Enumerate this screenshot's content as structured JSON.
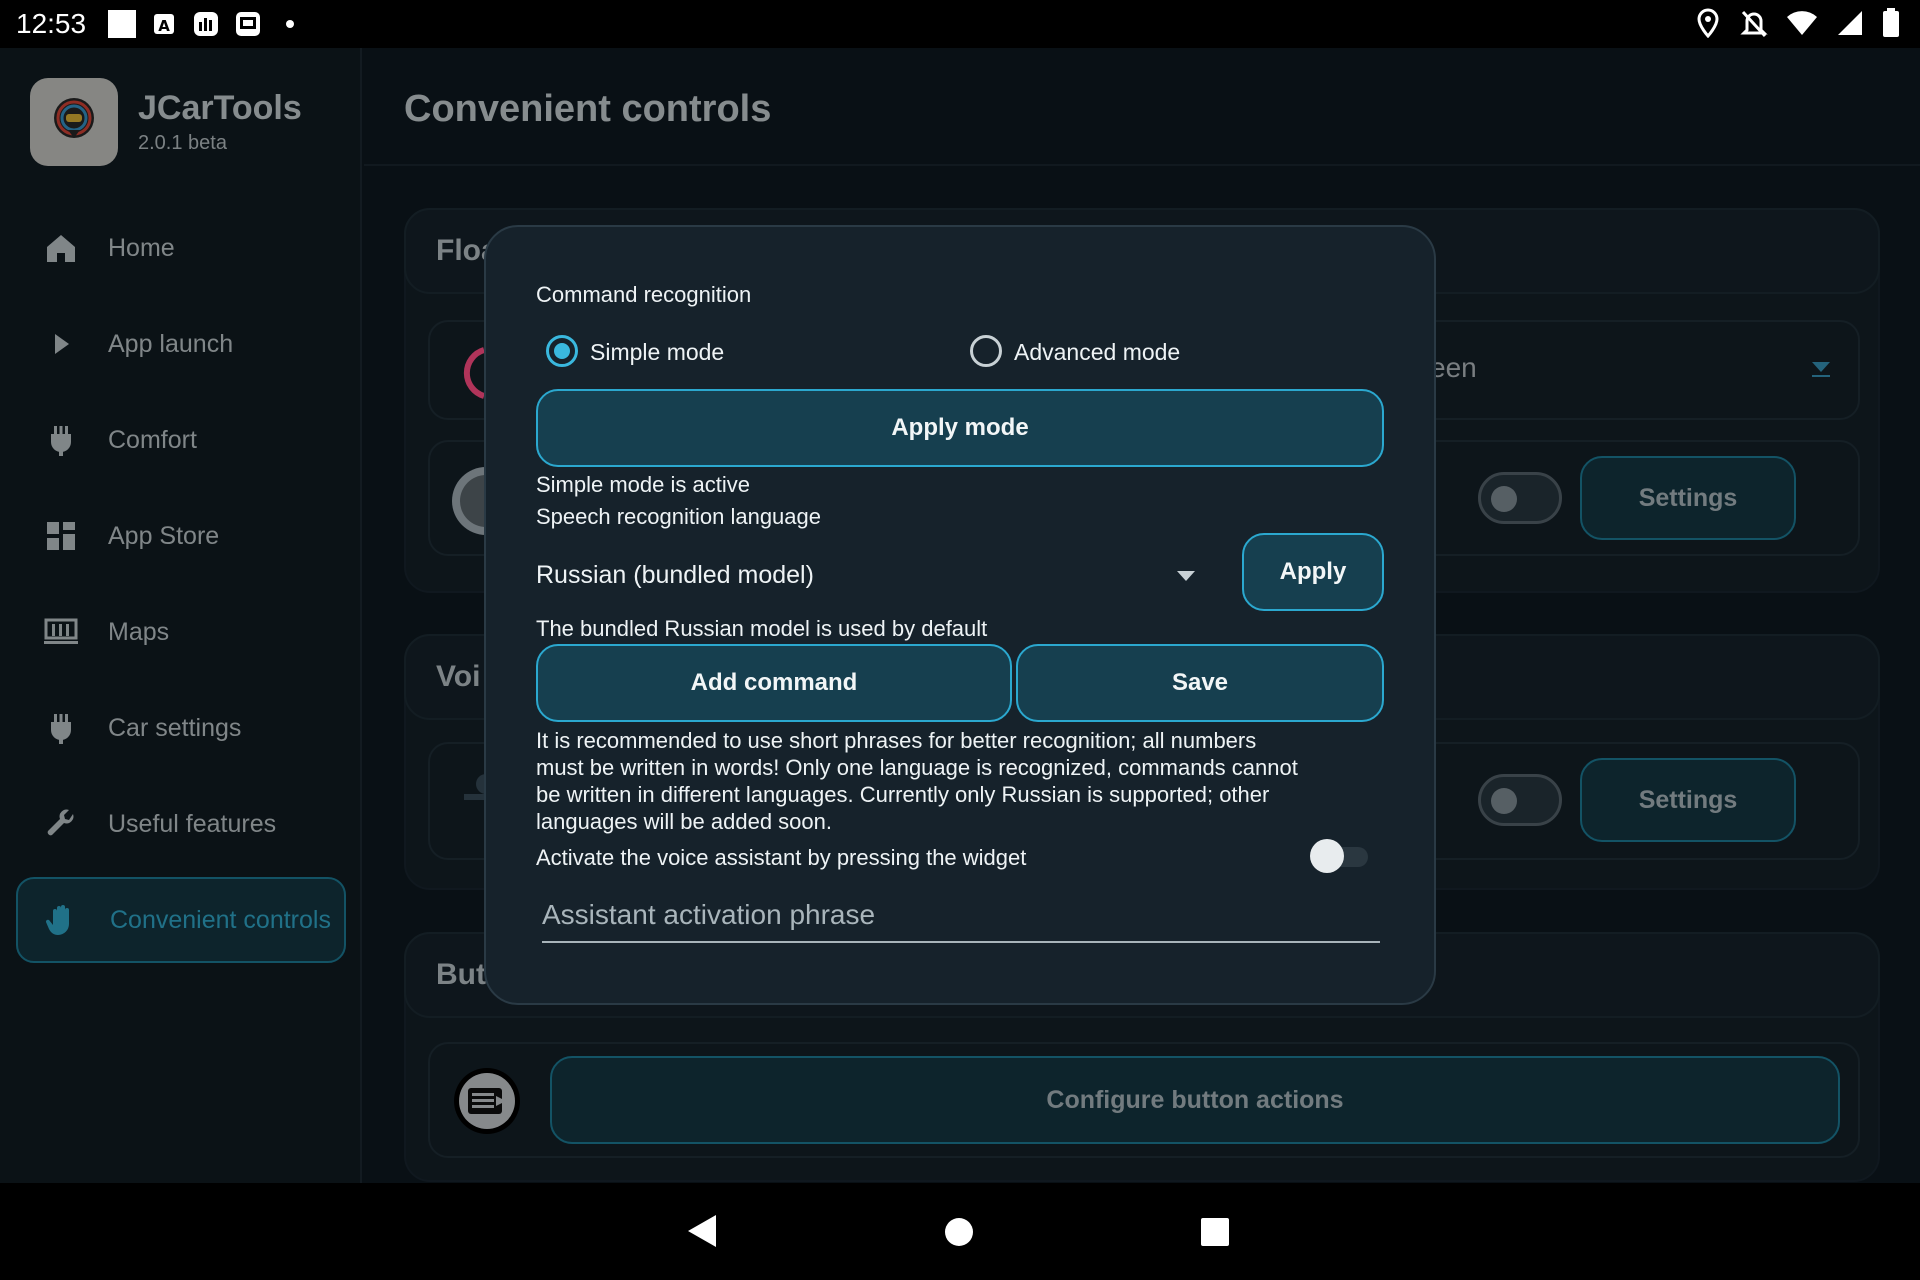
{
  "status_bar": {
    "time": "12:53"
  },
  "app": {
    "name": "JCarTools",
    "version": "2.0.1 beta"
  },
  "sidebar": {
    "items": [
      {
        "label": "Home",
        "icon": "home-icon"
      },
      {
        "label": "App launch",
        "icon": "play-icon"
      },
      {
        "label": "Comfort",
        "icon": "plug-icon"
      },
      {
        "label": "App Store",
        "icon": "apps-grid-icon"
      },
      {
        "label": "Maps",
        "icon": "map-icon"
      },
      {
        "label": "Car settings",
        "icon": "plug-icon"
      },
      {
        "label": "Useful features",
        "icon": "wrench-icon"
      },
      {
        "label": "Convenient controls",
        "icon": "hand-icon",
        "active": true
      }
    ]
  },
  "main": {
    "title": "Convenient controls",
    "card1": {
      "title_partial": "Floa",
      "select_partial": "een",
      "settings_label": "Settings"
    },
    "card2": {
      "title_partial": "Voi",
      "settings_label": "Settings"
    },
    "card3": {
      "title_partial": "But",
      "configure_label": "Configure button actions"
    }
  },
  "dialog": {
    "section_label": "Command recognition",
    "radio_simple": "Simple mode",
    "radio_advanced": "Advanced mode",
    "selected_mode": "Simple mode",
    "apply_mode_label": "Apply mode",
    "mode_status": "Simple mode is active",
    "language_label": "Speech recognition language",
    "language_value": "Russian (bundled model)",
    "apply_label": "Apply",
    "language_note": "The bundled Russian model is used by default",
    "add_command_label": "Add command",
    "save_label": "Save",
    "recommendation_lines": [
      "It is recommended to use short phrases for better recognition; all numbers",
      "must be written in words! Only one language is recognized, commands cannot",
      "be written in different languages. Currently only Russian is supported; other",
      "languages will be added soon."
    ],
    "widget_toggle_label": "Activate the voice assistant by pressing the widget",
    "widget_toggle_on": false,
    "activation_phrase_placeholder": "Assistant activation phrase"
  },
  "colors": {
    "accent": "#35b7db",
    "button_fill": "#163f4f",
    "background": "#0f1a22"
  }
}
